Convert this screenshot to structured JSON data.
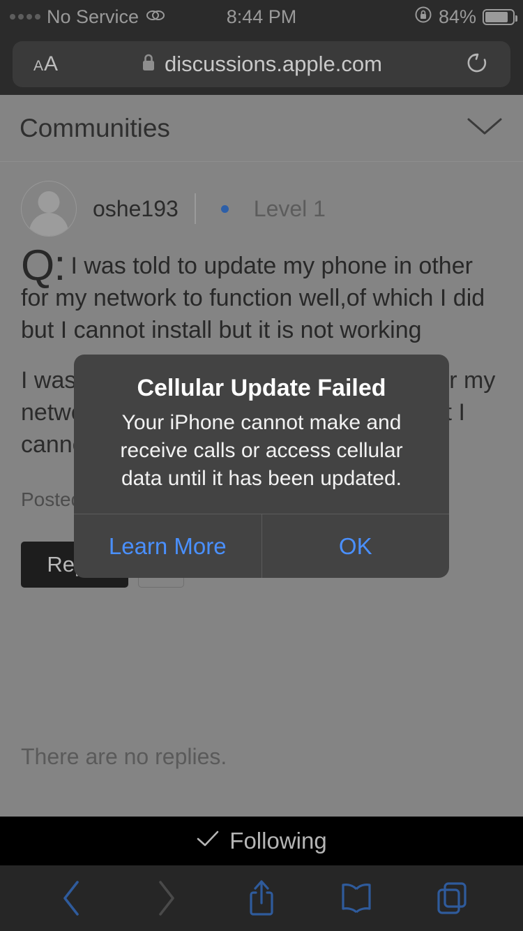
{
  "status_bar": {
    "carrier": "No Service",
    "link_icon": "link-icon",
    "time": "8:44 PM",
    "rotation_lock_icon": "rotation-lock-icon",
    "battery_percent": "84%",
    "battery_level": 84
  },
  "browser": {
    "text_size_small": "A",
    "text_size_large": "A",
    "lock_icon": "lock-icon",
    "url": "discussions.apple.com",
    "reload_icon": "reload-icon",
    "toolbar": {
      "back": "back-icon",
      "forward": "forward-icon",
      "share": "share-icon",
      "bookmarks": "bookmarks-icon",
      "tabs": "tabs-icon"
    }
  },
  "page": {
    "header": {
      "title": "Communities",
      "chevron": "chevron-down-icon"
    },
    "post": {
      "author": "oshe193",
      "level": "Level 1",
      "question_prefix": "Q:",
      "question": "I was told to update my phone in other for my network to function well,of which I did but I cannot install but it is not working",
      "body": "I was told to update my phone in other for my network to function well,of which I did but I cannot install but it is not working",
      "posted": "Posted",
      "reply_label": "Reply",
      "reply_dropdown_icon": "chevron-down-icon"
    },
    "no_replies": "There are no replies.",
    "following": {
      "label": "Following",
      "check_icon": "check-icon"
    }
  },
  "dialog": {
    "title": "Cellular Update Failed",
    "message": "Your iPhone cannot make and receive calls or access cellular data until it has been updated.",
    "learn_more_label": "Learn More",
    "ok_label": "OK",
    "accent_color": "#4a90ff",
    "background_color": "#434343"
  }
}
